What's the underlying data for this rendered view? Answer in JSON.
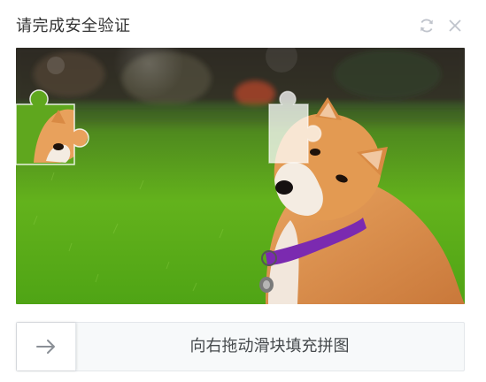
{
  "dialog": {
    "title": "请完成安全验证"
  },
  "toolbar": {
    "refresh_icon": "refresh-icon",
    "close_icon": "close-icon"
  },
  "captcha": {
    "image_subject": "shiba-inu-dog-on-grass",
    "puzzle_piece_icon": "jigsaw-piece",
    "slider_hint": "向右拖动滑块填充拼图",
    "slider_icon": "arrow-right-icon",
    "slider_progress": 0
  },
  "colors": {
    "title_text": "#333333",
    "icon_gray": "#c0c4cc",
    "track_bg": "#f7f9fa",
    "track_border": "#e4e7eb",
    "hint_text": "#45494c"
  }
}
